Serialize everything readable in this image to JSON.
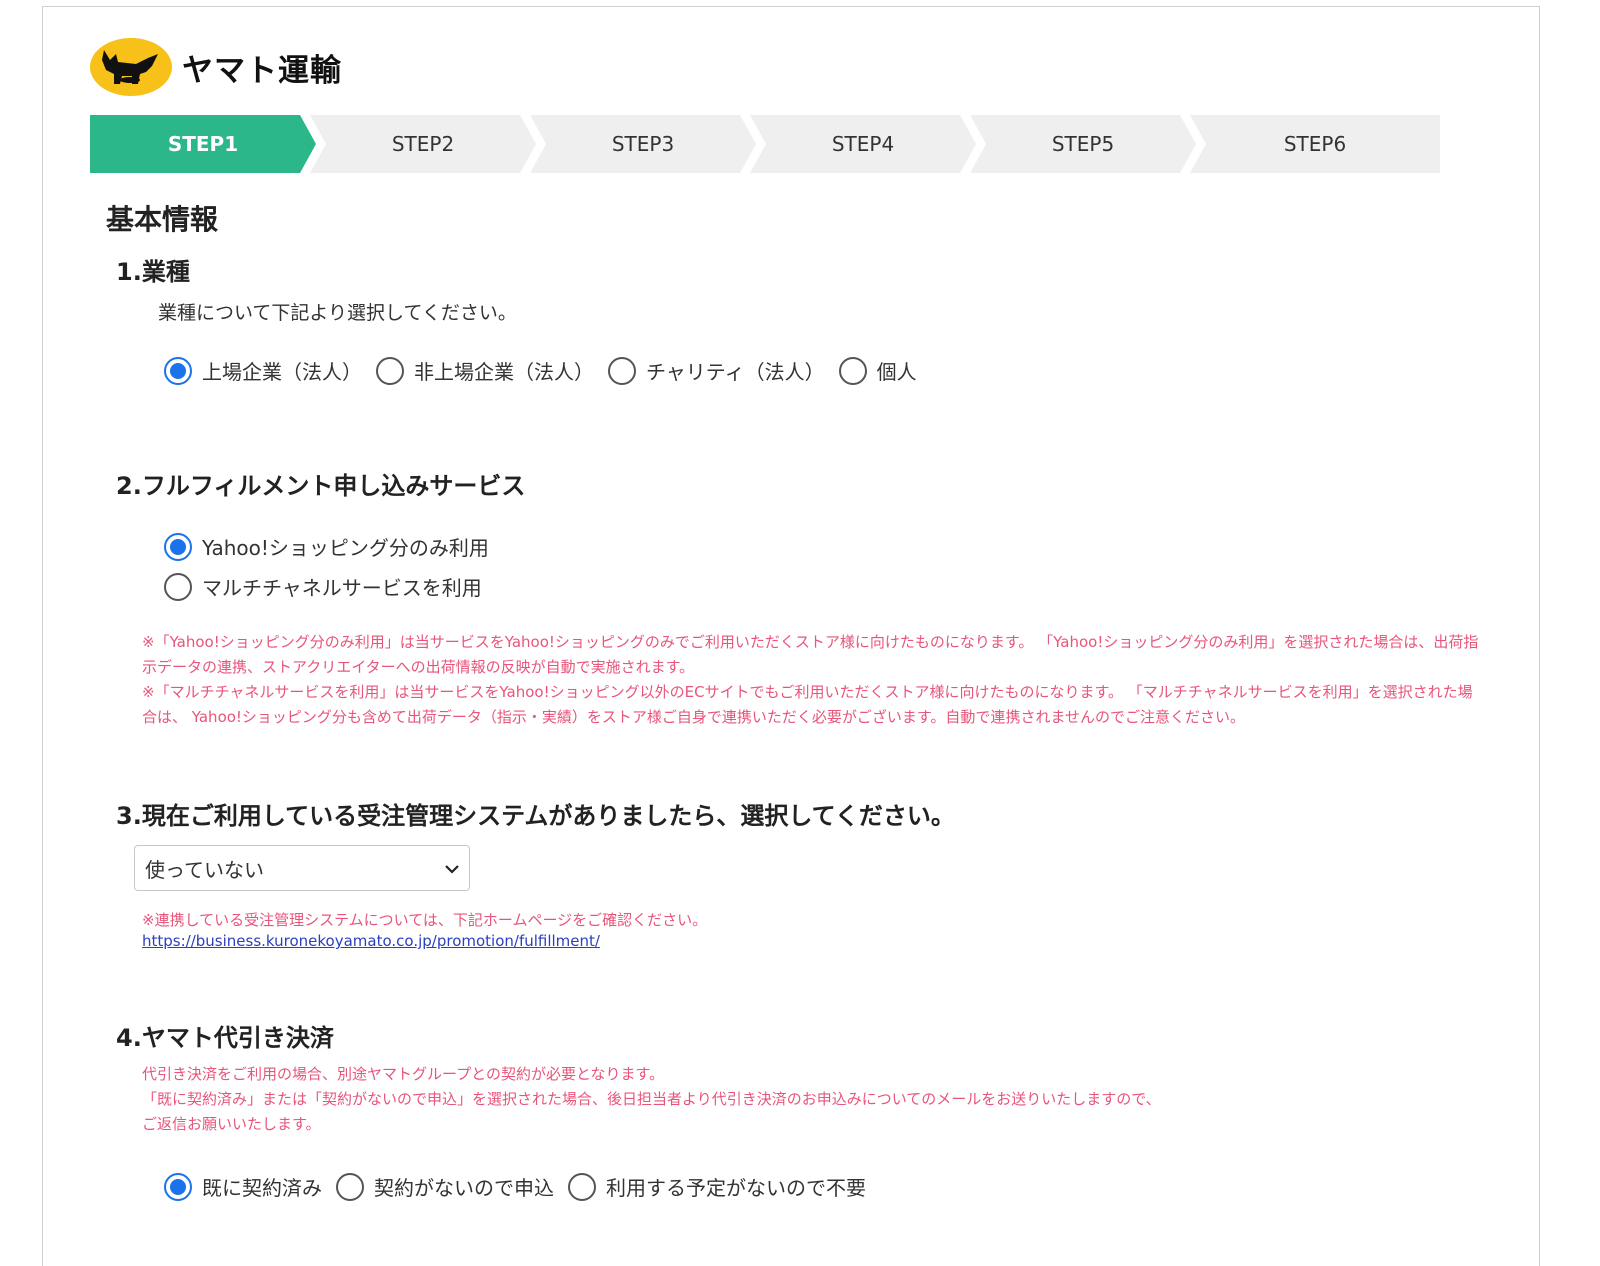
{
  "brand": {
    "name": "ヤマト運輸"
  },
  "steps": [
    "STEP1",
    "STEP2",
    "STEP3",
    "STEP4",
    "STEP5",
    "STEP6"
  ],
  "active_step": "STEP1",
  "section_title": "基本情報",
  "q1": {
    "title": "1.業種",
    "description": "業種について下記より選択してください。",
    "options": [
      "上場企業（法人）",
      "非上場企業（法人）",
      "チャリティ（法人）",
      "個人"
    ],
    "selected": "上場企業（法人）"
  },
  "q2": {
    "title": "2.フルフィルメント申し込みサービス",
    "options": [
      "Yahoo!ショッピング分のみ利用",
      "マルチチャネルサービスを利用"
    ],
    "selected": "Yahoo!ショッピング分のみ利用",
    "notes": [
      "※「Yahoo!ショッピング分のみ利用」は当サービスをYahoo!ショッピングのみでご利用いただくストア様に向けたものになります。 「Yahoo!ショッピング分のみ利用」を選択された場合は、出荷指示データの連携、ストアクリエイターへの出荷情報の反映が自動で実施されます。",
      "※「マルチチャネルサービスを利用」は当サービスをYahoo!ショッピング以外のECサイトでもご利用いただくストア様に向けたものになります。 「マルチチャネルサービスを利用」を選択された場合は、 Yahoo!ショッピング分も含めて出荷データ（指示・実績）をストア様ご自身で連携いただく必要がございます。自動で連携されませんのでご注意ください。"
    ]
  },
  "q3": {
    "title": "3.現在ご利用している受注管理システムがありましたら、選択してください。",
    "select_value": "使っていない",
    "note": "※連携している受注管理システムについては、下記ホームページをご確認ください。",
    "link": "https://business.kuronekoyamato.co.jp/promotion/fulfillment/"
  },
  "q4": {
    "title": "4.ヤマト代引き決済",
    "notes": [
      "代引き決済をご利用の場合、別途ヤマトグループとの契約が必要となります。",
      "「既に契約済み」または「契約がないので申込」を選択された場合、後日担当者より代引き決済のお申込みについてのメールをお送りいたしますので、",
      "ご返信お願いいたします。"
    ],
    "options": [
      "既に契約済み",
      "契約がないので申込",
      "利用する予定がないので不要"
    ],
    "selected": "既に契約済み"
  },
  "colors": {
    "accent": "#2bb789",
    "radio": "#1a73e8",
    "note": "#e8557b",
    "link": "#2a3fc2",
    "logo": "#f7c11a"
  },
  "icons": {
    "logo": "black-cat-icon",
    "select": "chevron-down-icon"
  }
}
